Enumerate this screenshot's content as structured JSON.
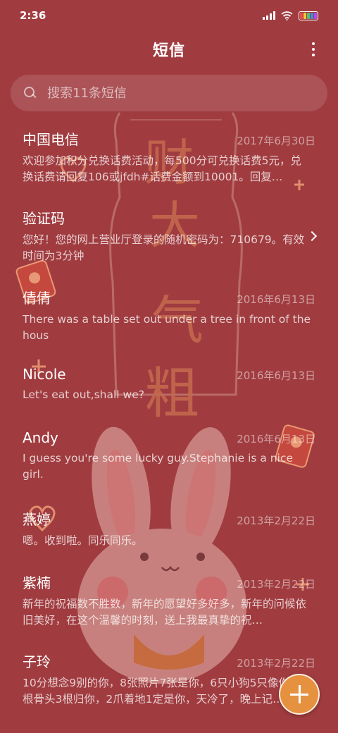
{
  "status_bar": {
    "time": "2:36",
    "battery_colors": [
      "#e84b4b",
      "#f4c542",
      "#4bc36b",
      "#3b8ef0",
      "#b04be8"
    ]
  },
  "header": {
    "title": "短信",
    "more_icon": "more-vertical-icon"
  },
  "search": {
    "placeholder": "搜索11条短信",
    "icon": "search-icon"
  },
  "wallpaper": {
    "text": [
      "财",
      "大",
      "气",
      "粗"
    ],
    "color": "#c66a4f"
  },
  "messages": [
    {
      "name": "中国电信",
      "date": "2017年6月30日",
      "preview": "欢迎参加积分兑换话费活动，每500分可兑换话费5元，兑换话费请回复106或jfdh#话费金额到10001。回复…"
    },
    {
      "name": "验证码",
      "date": "",
      "preview": "您好！您的网上营业厅登录的随机密码为：710679。有效时间为3分钟",
      "has_chevron": true
    },
    {
      "name": "倩倩",
      "date": "2016年6月13日",
      "preview": "There was a table set out under a tree in front of the hous"
    },
    {
      "name": "Nicole",
      "date": "2016年6月13日",
      "preview": "Let's eat out,shall we?"
    },
    {
      "name": "Andy",
      "date": "2016年6月13日",
      "preview": "I guess you're some lucky guy.Stephanie is a nice girl."
    },
    {
      "name": "燕婷",
      "date": "2013年2月22日",
      "preview": "嗯。收到啦。同乐同乐。"
    },
    {
      "name": "紫楠",
      "date": "2013年2月22日",
      "preview": "新年的祝福数不胜数，新年的愿望好多好多，新年的问候依旧美好，在这个温馨的时刻，送上我最真挚的祝…"
    },
    {
      "name": "子玲",
      "date": "2013年2月22日",
      "preview": "10分想念9别的你，8张照片7张是你，6只小狗5只像你，4根骨头3根归你，2爪着地1定是你，天冷了，晚上记…"
    }
  ],
  "fab": {
    "icon": "plus-icon",
    "color": "#e6913f"
  }
}
